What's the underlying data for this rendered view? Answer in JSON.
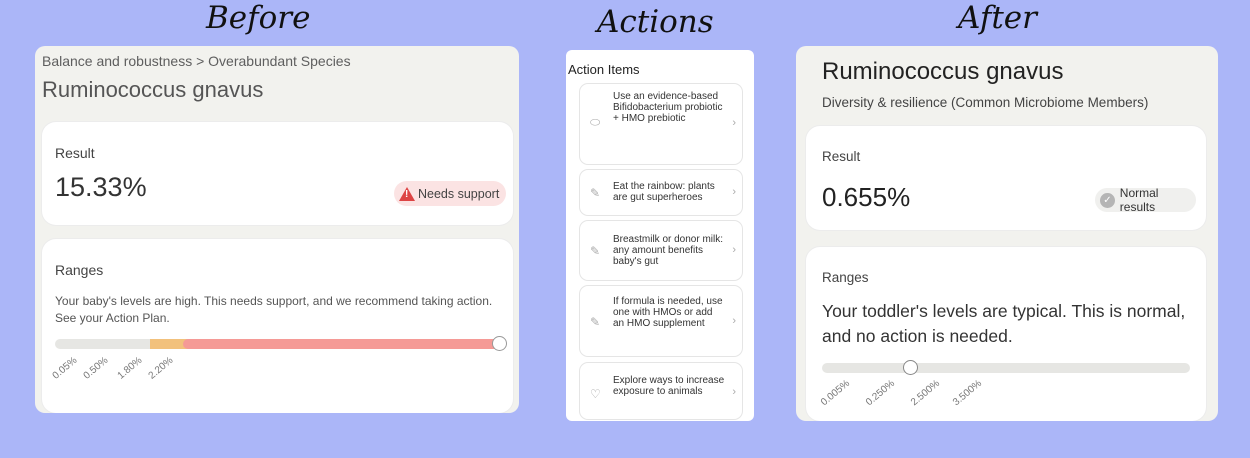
{
  "headings": {
    "before": "Before",
    "actions": "Actions",
    "after": "After"
  },
  "before": {
    "breadcrumb": "Balance and robustness > Overabundant Species",
    "title": "Ruminococcus gnavus",
    "result": {
      "label": "Result",
      "value": "15.33%",
      "badge": "Needs support",
      "badge_color": "#d44444"
    },
    "ranges": {
      "label": "Ranges",
      "text": "Your baby's levels are high. This needs support, and we recommend taking action. See your Action Plan.",
      "ticks": [
        "0.05%",
        "0.50%",
        "1.80%",
        "2.20%"
      ],
      "colors": {
        "normal": "#e6e6e3",
        "warning": "#f2c17c",
        "high": "#f59a96"
      }
    }
  },
  "actions": {
    "title": "Action Items",
    "items": [
      {
        "icon": "pill-icon",
        "label": "Use an evidence-based Bifidobacterium probiotic + HMO prebiotic"
      },
      {
        "icon": "carrot-icon",
        "label": "Eat the rainbow: plants are gut superheroes"
      },
      {
        "icon": "carrot-icon",
        "label": "Breastmilk or donor milk: any amount benefits baby's gut"
      },
      {
        "icon": "carrot-icon",
        "label": "If formula is needed, use one with HMOs or add an HMO supplement"
      },
      {
        "icon": "heart-icon",
        "label": "Explore ways to increase exposure to animals"
      }
    ]
  },
  "after": {
    "title": "Ruminococcus gnavus",
    "subtitle": "Diversity & resilience (Common Microbiome Members)",
    "result": {
      "label": "Result",
      "value": "0.655%",
      "badge": "Normal results"
    },
    "ranges": {
      "label": "Ranges",
      "text": "Your toddler's levels are typical. This is normal, and no action is needed.",
      "ticks": [
        "0.005%",
        "0.250%",
        "2.500%",
        "3.500%"
      ]
    }
  }
}
